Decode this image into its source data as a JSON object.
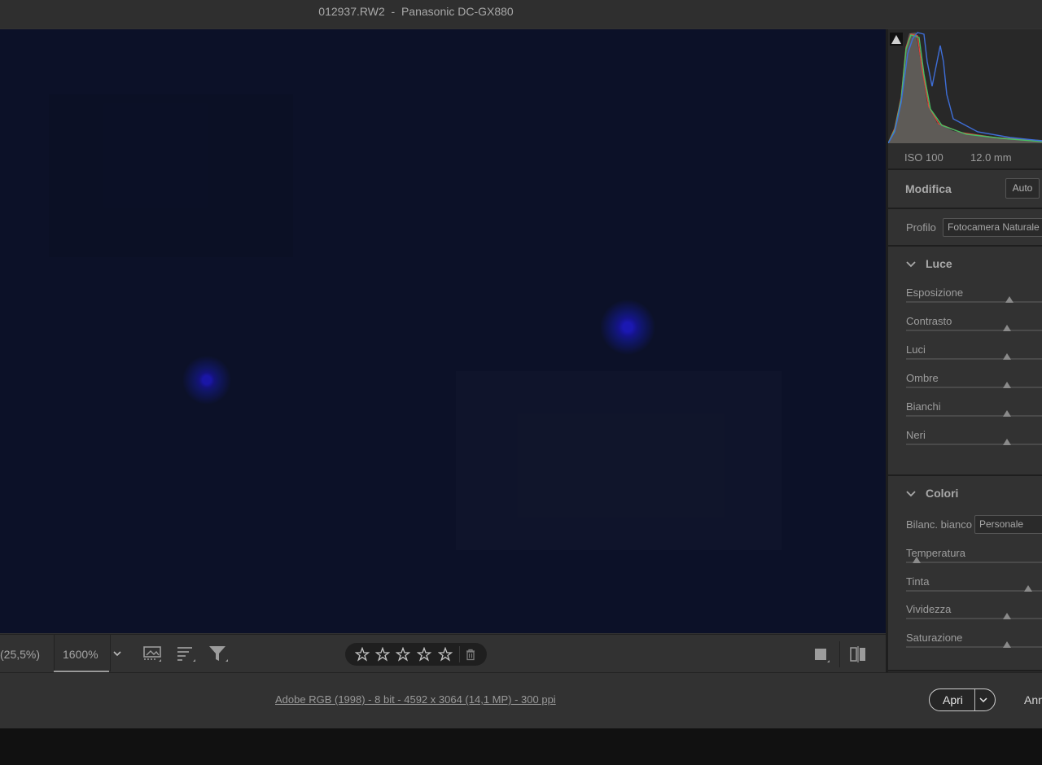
{
  "titlebar": {
    "title": "012937.RW2  -  Panasonic DC-GX880"
  },
  "toolbar": {
    "zoom_fit": "(25,5%)",
    "zoom_value": "1600%",
    "rating_stars": 5,
    "icons": [
      "filmstrip-icon",
      "sort-icon",
      "filter-icon",
      "single-view-icon",
      "compare-view-icon"
    ]
  },
  "histogram": {
    "iso": "ISO 100",
    "focal": "12.0 mm",
    "colors": {
      "red": "#d9473e",
      "green": "#46c065",
      "blue": "#3e6ed8"
    }
  },
  "edit": {
    "title": "Modifica",
    "auto": "Auto",
    "profile_label": "Profilo",
    "profile_value": "Fotocamera Naturale"
  },
  "luce": {
    "title": "Luce",
    "sliders": [
      {
        "label": "Esposizione",
        "value": 0.76
      },
      {
        "label": "Contrasto",
        "value": 0.74
      },
      {
        "label": "Luci",
        "value": 0.74
      },
      {
        "label": "Ombre",
        "value": 0.74
      },
      {
        "label": "Bianchi",
        "value": 0.74
      },
      {
        "label": "Neri",
        "value": 0.74
      }
    ]
  },
  "colori": {
    "title": "Colori",
    "wb_label": "Bilanc. bianco",
    "wb_value": "Personale",
    "sliders": [
      {
        "label": "Temperatura",
        "value": 0.08
      },
      {
        "label": "Tinta",
        "value": 0.9
      },
      {
        "label": "Vividezza",
        "value": 0.74
      },
      {
        "label": "Saturazione",
        "value": 0.74
      }
    ]
  },
  "footer": {
    "info": "Adobe RGB (1998) - 8 bit - 4592 x 3064 (14,1 MP) - 300 ppi",
    "open": "Apri",
    "cancel": "Annulla"
  },
  "accent": "#9a9a9a",
  "image_bg": "#0c1128"
}
